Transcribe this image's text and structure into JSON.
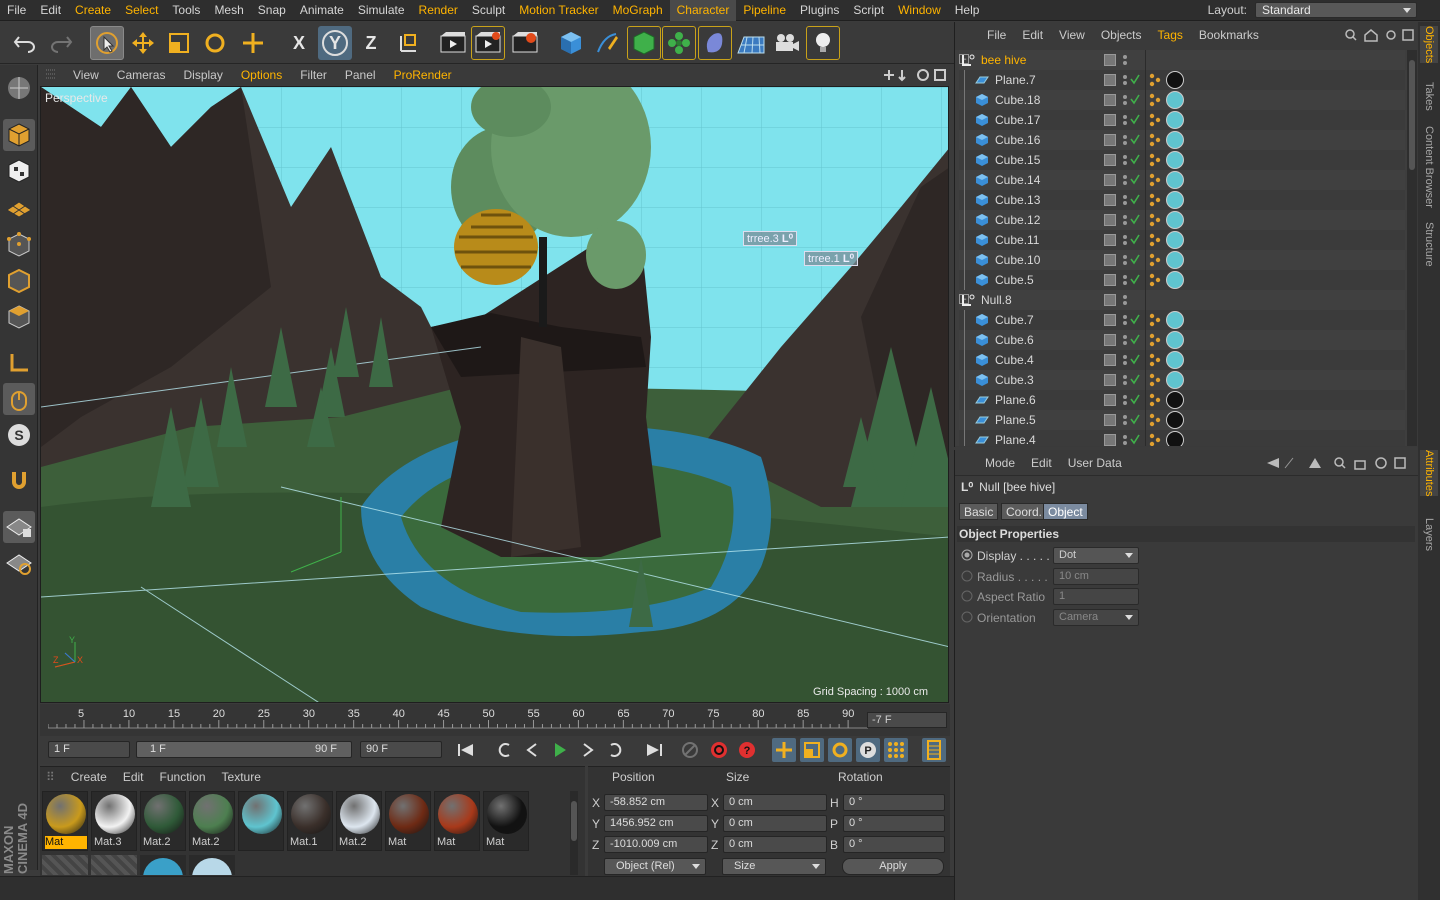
{
  "menubar": {
    "items": [
      {
        "label": "File",
        "hl": false
      },
      {
        "label": "Edit",
        "hl": false
      },
      {
        "label": "Create",
        "hl": true
      },
      {
        "label": "Select",
        "hl": true
      },
      {
        "label": "Tools",
        "hl": false
      },
      {
        "label": "Mesh",
        "hl": false
      },
      {
        "label": "Snap",
        "hl": false
      },
      {
        "label": "Animate",
        "hl": false
      },
      {
        "label": "Simulate",
        "hl": false
      },
      {
        "label": "Render",
        "hl": true
      },
      {
        "label": "Sculpt",
        "hl": false
      },
      {
        "label": "Motion Tracker",
        "hl": true
      },
      {
        "label": "MoGraph",
        "hl": true
      },
      {
        "label": "Character",
        "hl": true
      },
      {
        "label": "Pipeline",
        "hl": true
      },
      {
        "label": "Plugins",
        "hl": false
      },
      {
        "label": "Script",
        "hl": false
      },
      {
        "label": "Window",
        "hl": true
      },
      {
        "label": "Help",
        "hl": false
      }
    ],
    "layout_label": "Layout:",
    "layout_value": "Standard"
  },
  "toolbar": {
    "x_label": "X",
    "y_label": "Y",
    "z_label": "Z"
  },
  "viewport_menu": {
    "items": [
      {
        "label": "View",
        "hl": false
      },
      {
        "label": "Cameras",
        "hl": false
      },
      {
        "label": "Display",
        "hl": false
      },
      {
        "label": "Options",
        "hl": true
      },
      {
        "label": "Filter",
        "hl": false
      },
      {
        "label": "Panel",
        "hl": false
      },
      {
        "label": "ProRender",
        "hl": true
      }
    ]
  },
  "viewport": {
    "label": "Perspective",
    "grid_spacing": "Grid Spacing : 1000 cm",
    "tag1": "trree.3",
    "tag2": "trree.1",
    "axis_y": "Y",
    "axis_z": "Z",
    "axis_x": "X"
  },
  "timeline": {
    "ticks": [
      "5",
      "10",
      "15",
      "20",
      "25",
      "30",
      "35",
      "40",
      "45",
      "50",
      "55",
      "60",
      "65",
      "70",
      "75",
      "80",
      "85",
      "90"
    ],
    "current": "-7 F"
  },
  "transport": {
    "start": "1 F",
    "range_start": "1 F",
    "range_end": "90 F",
    "end": "90 F"
  },
  "materials": {
    "menu": [
      "Create",
      "Edit",
      "Function",
      "Texture"
    ],
    "items": [
      {
        "label": "Mat",
        "color": "#c99a1c",
        "sel": true
      },
      {
        "label": "Mat.3",
        "color": "#f2f2f2",
        "sel": false
      },
      {
        "label": "Mat.2",
        "color": "#2f5a38",
        "sel": false
      },
      {
        "label": "Mat.2",
        "color": "#4d7f50",
        "sel": false
      },
      {
        "label": "",
        "color": "#5fc4cf",
        "sel": false
      },
      {
        "label": "Mat.1",
        "color": "#3a2f2a",
        "sel": false
      },
      {
        "label": "Mat.2",
        "color": "#dde6ef",
        "sel": false
      },
      {
        "label": "Mat",
        "color": "#6e2a14",
        "sel": false
      },
      {
        "label": "Mat",
        "color": "#a8391a",
        "sel": false
      },
      {
        "label": "Mat",
        "color": "#121212",
        "sel": false
      }
    ]
  },
  "coords": {
    "headers": [
      "Position",
      "Size",
      "Rotation"
    ],
    "rows": [
      {
        "axis": "X",
        "pos": "-58.852 cm",
        "saxis": "X",
        "size": "0 cm",
        "raxis": "H",
        "rot": "0 °"
      },
      {
        "axis": "Y",
        "pos": "1456.952 cm",
        "saxis": "Y",
        "size": "0 cm",
        "raxis": "P",
        "rot": "0 °"
      },
      {
        "axis": "Z",
        "pos": "-1010.009 cm",
        "saxis": "Z",
        "size": "0 cm",
        "raxis": "B",
        "rot": "0 °"
      }
    ],
    "mode": "Object (Rel)",
    "size_mode": "Size",
    "apply": "Apply"
  },
  "brand": "MAXON CINEMA 4D",
  "objects": {
    "menu": [
      {
        "label": "File",
        "hl": false
      },
      {
        "label": "Edit",
        "hl": false
      },
      {
        "label": "View",
        "hl": false
      },
      {
        "label": "Objects",
        "hl": false
      },
      {
        "label": "Tags",
        "hl": true
      },
      {
        "label": "Bookmarks",
        "hl": false
      }
    ],
    "rows": [
      {
        "name": "bee hive",
        "type": "null",
        "hl": true,
        "indent": 0,
        "mat": ""
      },
      {
        "name": "Plane.7",
        "type": "plane",
        "hl": false,
        "indent": 1,
        "mat": "#111111"
      },
      {
        "name": "Cube.18",
        "type": "cube",
        "hl": false,
        "indent": 1,
        "mat": "#5fc4cf"
      },
      {
        "name": "Cube.17",
        "type": "cube",
        "hl": false,
        "indent": 1,
        "mat": "#5fc4cf"
      },
      {
        "name": "Cube.16",
        "type": "cube",
        "hl": false,
        "indent": 1,
        "mat": "#5fc4cf"
      },
      {
        "name": "Cube.15",
        "type": "cube",
        "hl": false,
        "indent": 1,
        "mat": "#5fc4cf"
      },
      {
        "name": "Cube.14",
        "type": "cube",
        "hl": false,
        "indent": 1,
        "mat": "#5fc4cf"
      },
      {
        "name": "Cube.13",
        "type": "cube",
        "hl": false,
        "indent": 1,
        "mat": "#5fc4cf"
      },
      {
        "name": "Cube.12",
        "type": "cube",
        "hl": false,
        "indent": 1,
        "mat": "#5fc4cf"
      },
      {
        "name": "Cube.11",
        "type": "cube",
        "hl": false,
        "indent": 1,
        "mat": "#5fc4cf"
      },
      {
        "name": "Cube.10",
        "type": "cube",
        "hl": false,
        "indent": 1,
        "mat": "#5fc4cf"
      },
      {
        "name": "Cube.5",
        "type": "cube",
        "hl": false,
        "indent": 1,
        "mat": "#5fc4cf"
      },
      {
        "name": "Null.8",
        "type": "null",
        "hl": false,
        "indent": 0,
        "mat": ""
      },
      {
        "name": "Cube.7",
        "type": "cube",
        "hl": false,
        "indent": 1,
        "mat": "#5fc4cf"
      },
      {
        "name": "Cube.6",
        "type": "cube",
        "hl": false,
        "indent": 1,
        "mat": "#5fc4cf"
      },
      {
        "name": "Cube.4",
        "type": "cube",
        "hl": false,
        "indent": 1,
        "mat": "#5fc4cf"
      },
      {
        "name": "Cube.3",
        "type": "cube",
        "hl": false,
        "indent": 1,
        "mat": "#5fc4cf"
      },
      {
        "name": "Plane.6",
        "type": "plane",
        "hl": false,
        "indent": 1,
        "mat": "#111111"
      },
      {
        "name": "Plane.5",
        "type": "plane",
        "hl": false,
        "indent": 1,
        "mat": "#111111"
      },
      {
        "name": "Plane.4",
        "type": "plane",
        "hl": false,
        "indent": 1,
        "mat": "#111111"
      }
    ]
  },
  "attributes": {
    "menu": [
      "Mode",
      "Edit",
      "User Data"
    ],
    "object_title": "Null [bee hive]",
    "tabs": [
      {
        "label": "Basic",
        "on": false
      },
      {
        "label": "Coord.",
        "on": false
      },
      {
        "label": "Object",
        "on": true
      }
    ],
    "section": "Object Properties",
    "props": [
      {
        "label": "Display . . . . .",
        "value": "Dot",
        "dim": false,
        "dropdown": true
      },
      {
        "label": "Radius . . . . .",
        "value": "10 cm",
        "dim": true,
        "dropdown": false
      },
      {
        "label": "Aspect Ratio",
        "value": "1",
        "dim": true,
        "dropdown": false
      },
      {
        "label": "Orientation",
        "value": "Camera",
        "dim": true,
        "dropdown": true
      }
    ]
  },
  "right_tabs": [
    {
      "label": "Objects",
      "on": true
    },
    {
      "label": "Takes",
      "on": false
    },
    {
      "label": "Content Browser",
      "on": false
    },
    {
      "label": "Structure",
      "on": false
    },
    {
      "label": "Attributes",
      "on": true
    },
    {
      "label": "Layers",
      "on": false
    }
  ]
}
